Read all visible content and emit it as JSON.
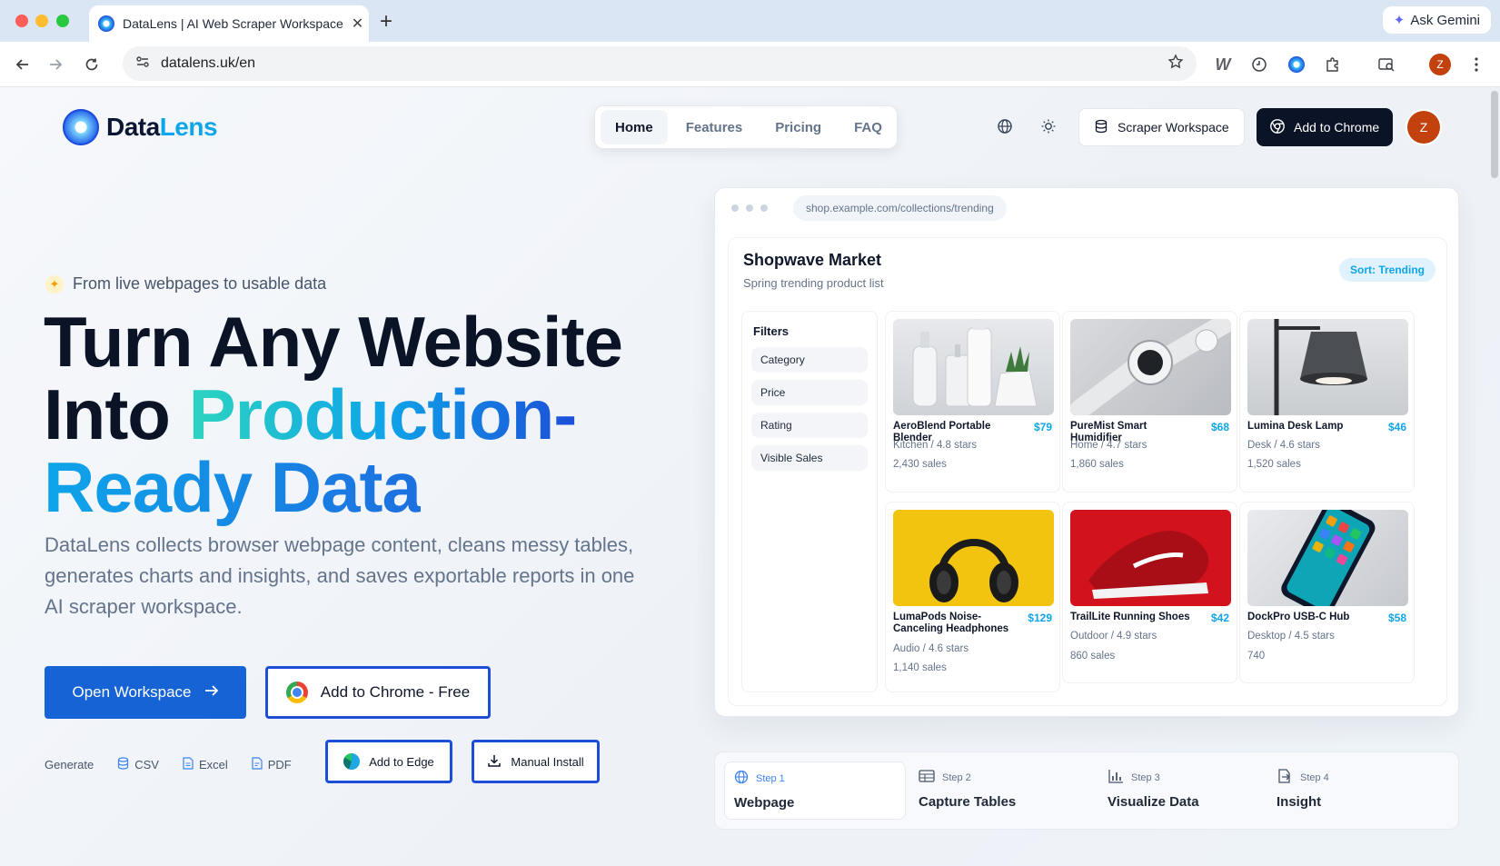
{
  "browser": {
    "tab_title": "DataLens | AI Web Scraper Workspace",
    "tab_close": "✕",
    "new_tab": "+",
    "ask_gemini": "Ask Gemini",
    "url": "datalens.uk/en",
    "profile_initial": "Z"
  },
  "header": {
    "logo_part1": "Data",
    "logo_part2": "Lens",
    "nav": [
      "Home",
      "Features",
      "Pricing",
      "FAQ"
    ],
    "active_nav": "Home",
    "workspace_button": "Scraper Workspace",
    "add_chrome_button": "Add to Chrome",
    "avatar_initial": "Z"
  },
  "hero": {
    "eyebrow": "From live webpages to usable data",
    "line1": "Turn Any Website",
    "line2_plain": "Into ",
    "line2_accent": "Production-",
    "line3_accent": "Ready Data",
    "subcopy": "DataLens collects browser webpage content, cleans messy tables, generates charts and insights, and saves exportable reports in one AI scraper workspace.",
    "open_workspace": "Open Workspace",
    "add_chrome_free": "Add to Chrome - Free",
    "generate_label": "Generate",
    "formats": [
      "CSV",
      "Excel",
      "PDF"
    ],
    "add_edge": "Add to Edge",
    "manual_install": "Manual Install"
  },
  "mock": {
    "url": "shop.example.com/collections/trending",
    "store_name": "Shopwave Market",
    "store_sub": "Spring trending product list",
    "sort": "Sort: Trending",
    "filters_title": "Filters",
    "filters": [
      "Category",
      "Price",
      "Rating",
      "Visible Sales"
    ],
    "products": [
      {
        "name": "AeroBlend Portable Blender",
        "price": "$79",
        "category": "Kitchen / 4.8 stars",
        "sales": "2,430 sales",
        "image": "bottles-and-plant"
      },
      {
        "name": "PureMist Smart Humidifier",
        "price": "$68",
        "category": "Home / 4.7 stars",
        "sales": "1,860 sales",
        "image": "smartwatch"
      },
      {
        "name": "Lumina Desk Lamp",
        "price": "$46",
        "category": "Desk / 4.6 stars",
        "sales": "1,520 sales",
        "image": "desk-lamp"
      },
      {
        "name": "LumaPods Noise-Canceling Headphones",
        "price": "$129",
        "category": "Audio / 4.6 stars",
        "sales": "1,140 sales",
        "image": "headphones"
      },
      {
        "name": "TrailLite Running Shoes",
        "price": "$42",
        "category": "Outdoor / 4.9 stars",
        "sales": "860 sales",
        "image": "red-shoe"
      },
      {
        "name": "DockPro USB-C Hub",
        "price": "$58",
        "category": "Desktop / 4.5 stars",
        "sales": "740",
        "image": "smartphone"
      }
    ]
  },
  "steps": [
    {
      "num": "Step 1",
      "label": "Webpage",
      "icon": "globe-icon"
    },
    {
      "num": "Step 2",
      "label": "Capture Tables",
      "icon": "table-icon"
    },
    {
      "num": "Step 3",
      "label": "Visualize Data",
      "icon": "bar-chart-icon"
    },
    {
      "num": "Step 4",
      "label": "Insight",
      "icon": "export-icon"
    }
  ],
  "colors": {
    "brand_blue": "#1663d6",
    "accent_cyan": "#0ea5e9",
    "dark_button": "#0b1426",
    "avatar": "#c2410c"
  }
}
